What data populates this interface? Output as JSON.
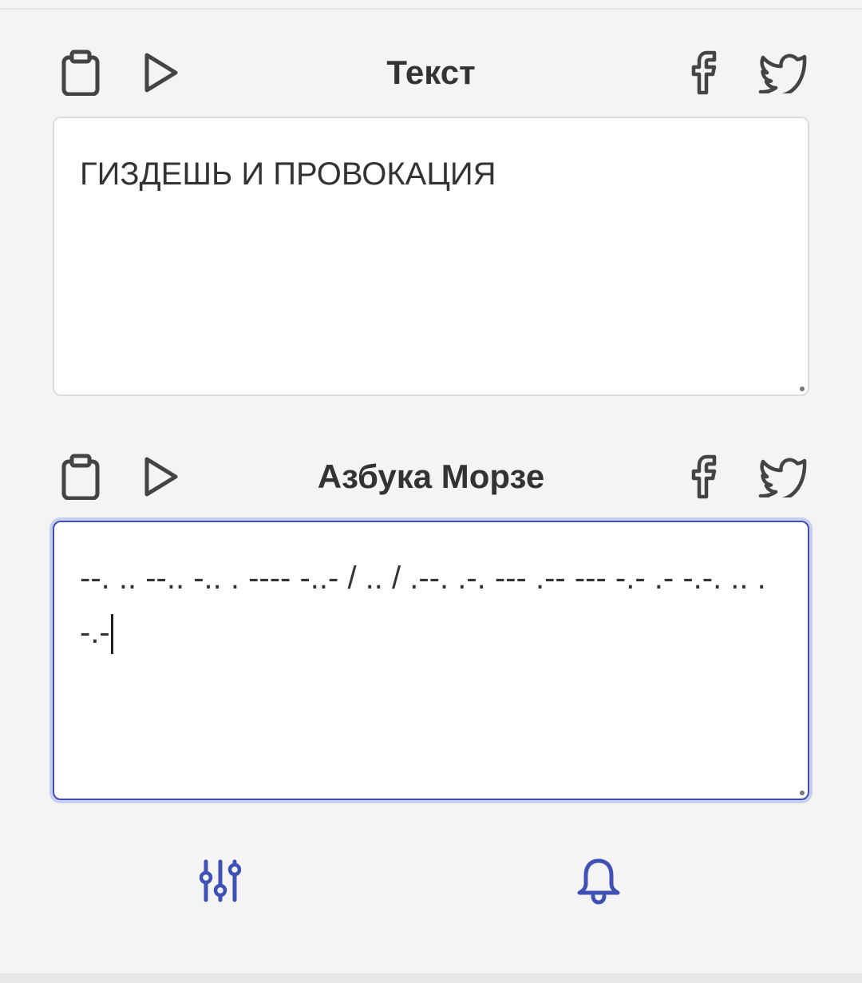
{
  "source_panel": {
    "title": "Текст",
    "text": "ГИЗДЕШЬ И ПРОВОКАЦИЯ",
    "icons": [
      "clipboard-icon",
      "play-icon",
      "facebook-icon",
      "twitter-icon"
    ]
  },
  "target_panel": {
    "title": "Азбука Морзе",
    "text": "--. .. --.. -.. . ---- -..- / .. / .--. .-. --- .-- --- -.- .- -.-. .. .-.-",
    "icons": [
      "clipboard-icon",
      "play-icon",
      "facebook-icon",
      "twitter-icon"
    ]
  },
  "bottom_nav": {
    "icons": [
      "settings-sliders-icon",
      "bell-icon"
    ]
  },
  "colors": {
    "background": "#f4f4f4",
    "text": "#333333",
    "icon": "#444444",
    "accent": "#3f51b5",
    "focus_ring": "#c9cfee"
  }
}
